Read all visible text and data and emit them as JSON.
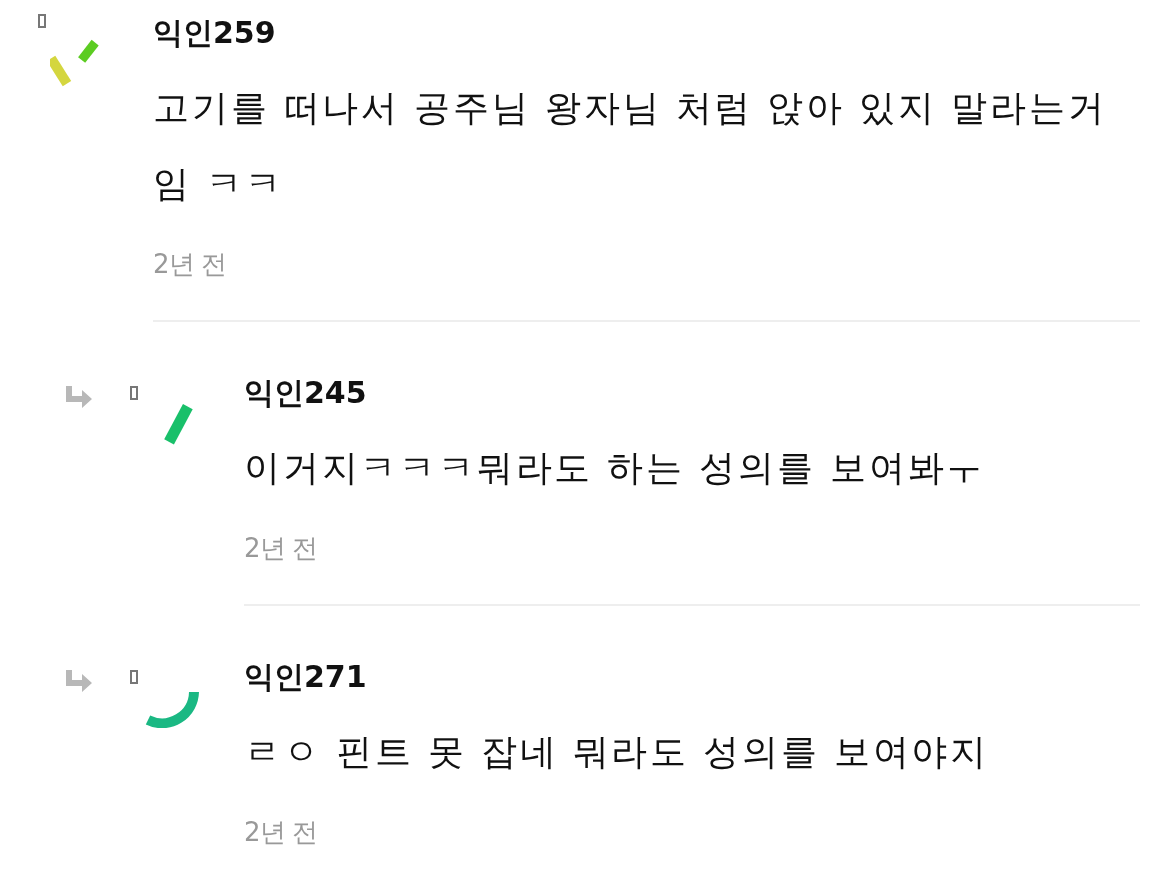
{
  "comments": [
    {
      "author": "익인259",
      "body": "고기를 떠나서 공주님 왕자님 처럼 앉아 있지 말라는거임 ㅋㅋ",
      "time": "2년 전",
      "reply": false
    },
    {
      "author": "익인245",
      "body": "이거지ㅋㅋㅋ뭐라도 하는 성의를 보여봐ㅜ",
      "time": "2년 전",
      "reply": true
    },
    {
      "author": "익인271",
      "body": "ㄹㅇ 핀트 못 잡네 뭐라도 성의를 보여야지",
      "time": "2년 전",
      "reply": true
    }
  ]
}
